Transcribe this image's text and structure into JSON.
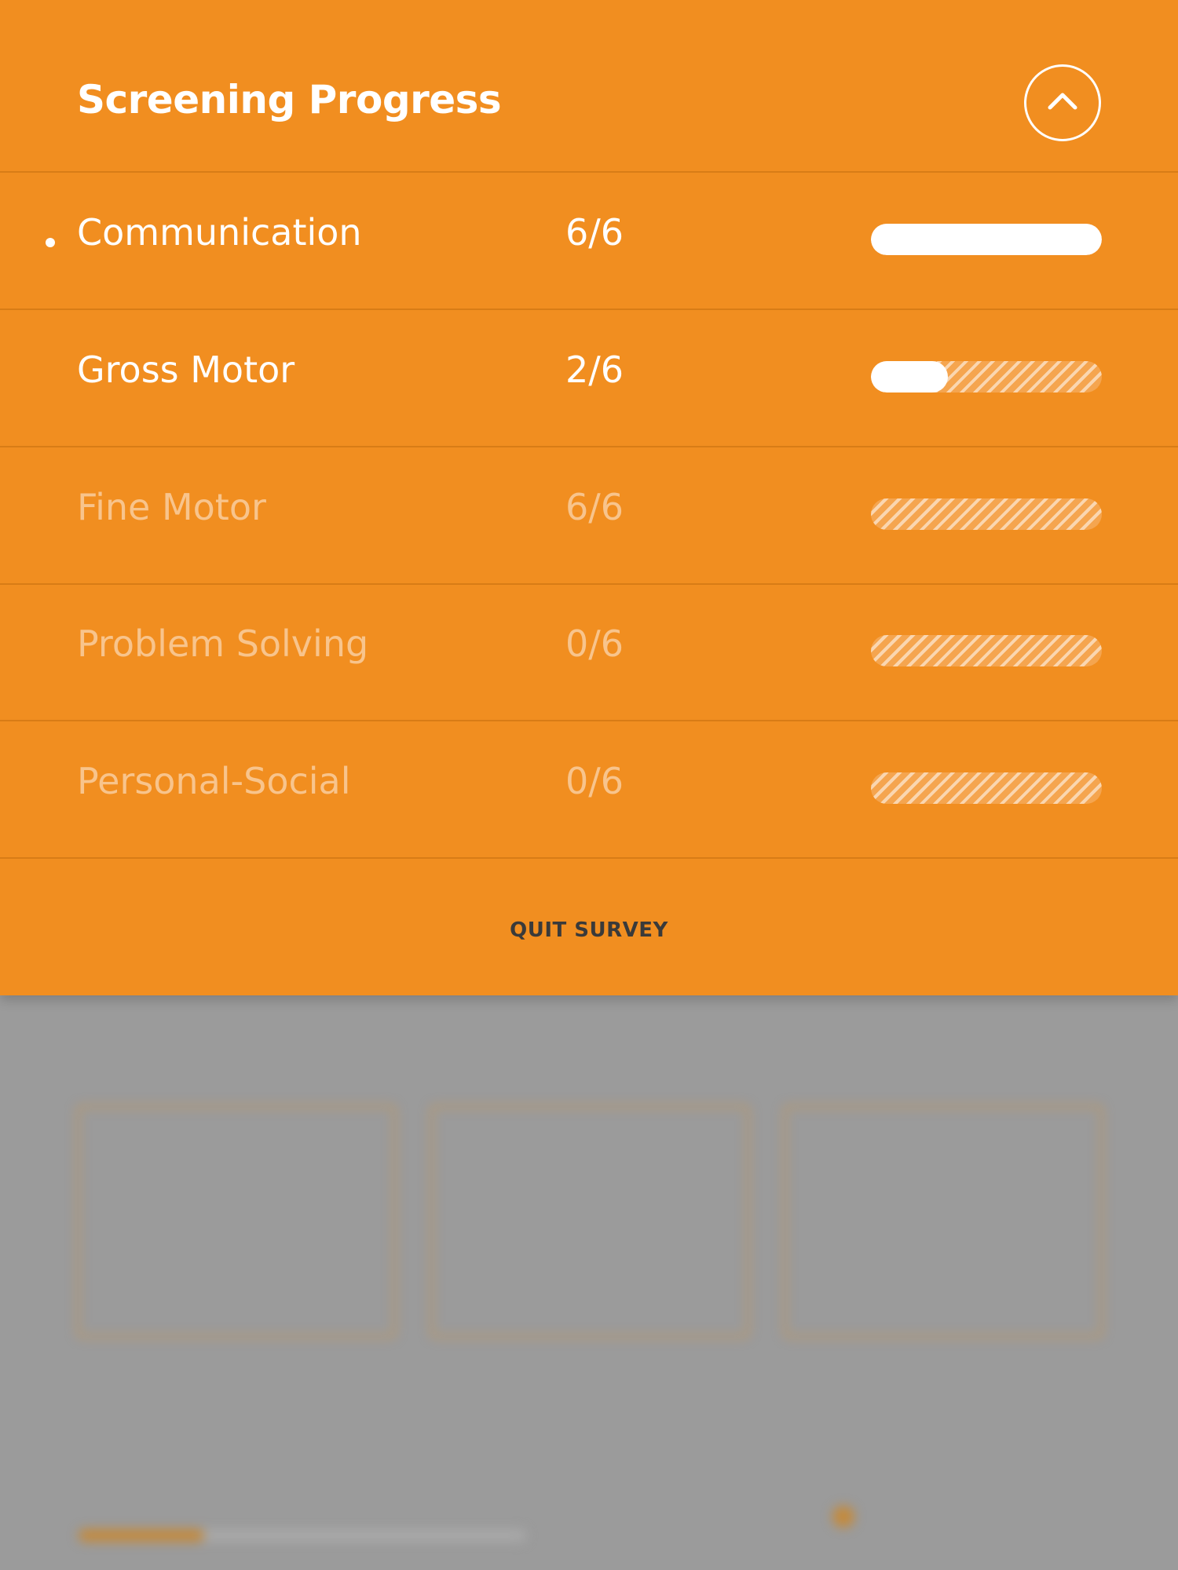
{
  "header": {
    "title": "Screening Progress",
    "collapse_icon": "chevron-up-icon"
  },
  "rows": [
    {
      "label": "Communication",
      "score": "6/6",
      "progress": 1.0,
      "active": true
    },
    {
      "label": "Gross Motor",
      "score": "2/6",
      "progress": 0.333,
      "active": false
    },
    {
      "label": "Fine Motor",
      "score": "6/6",
      "progress": 0,
      "active": false
    },
    {
      "label": "Problem Solving",
      "score": "0/6",
      "progress": 0,
      "active": false
    },
    {
      "label": "Personal-Social",
      "score": "0/6",
      "progress": 0,
      "active": false
    }
  ],
  "footer": {
    "quit_label": "QUIT SURVEY"
  },
  "colors": {
    "accent": "#F18E20",
    "text": "#FFFFFF",
    "dim_text": "#F8C48C",
    "overlay": "#9B9B9B"
  }
}
